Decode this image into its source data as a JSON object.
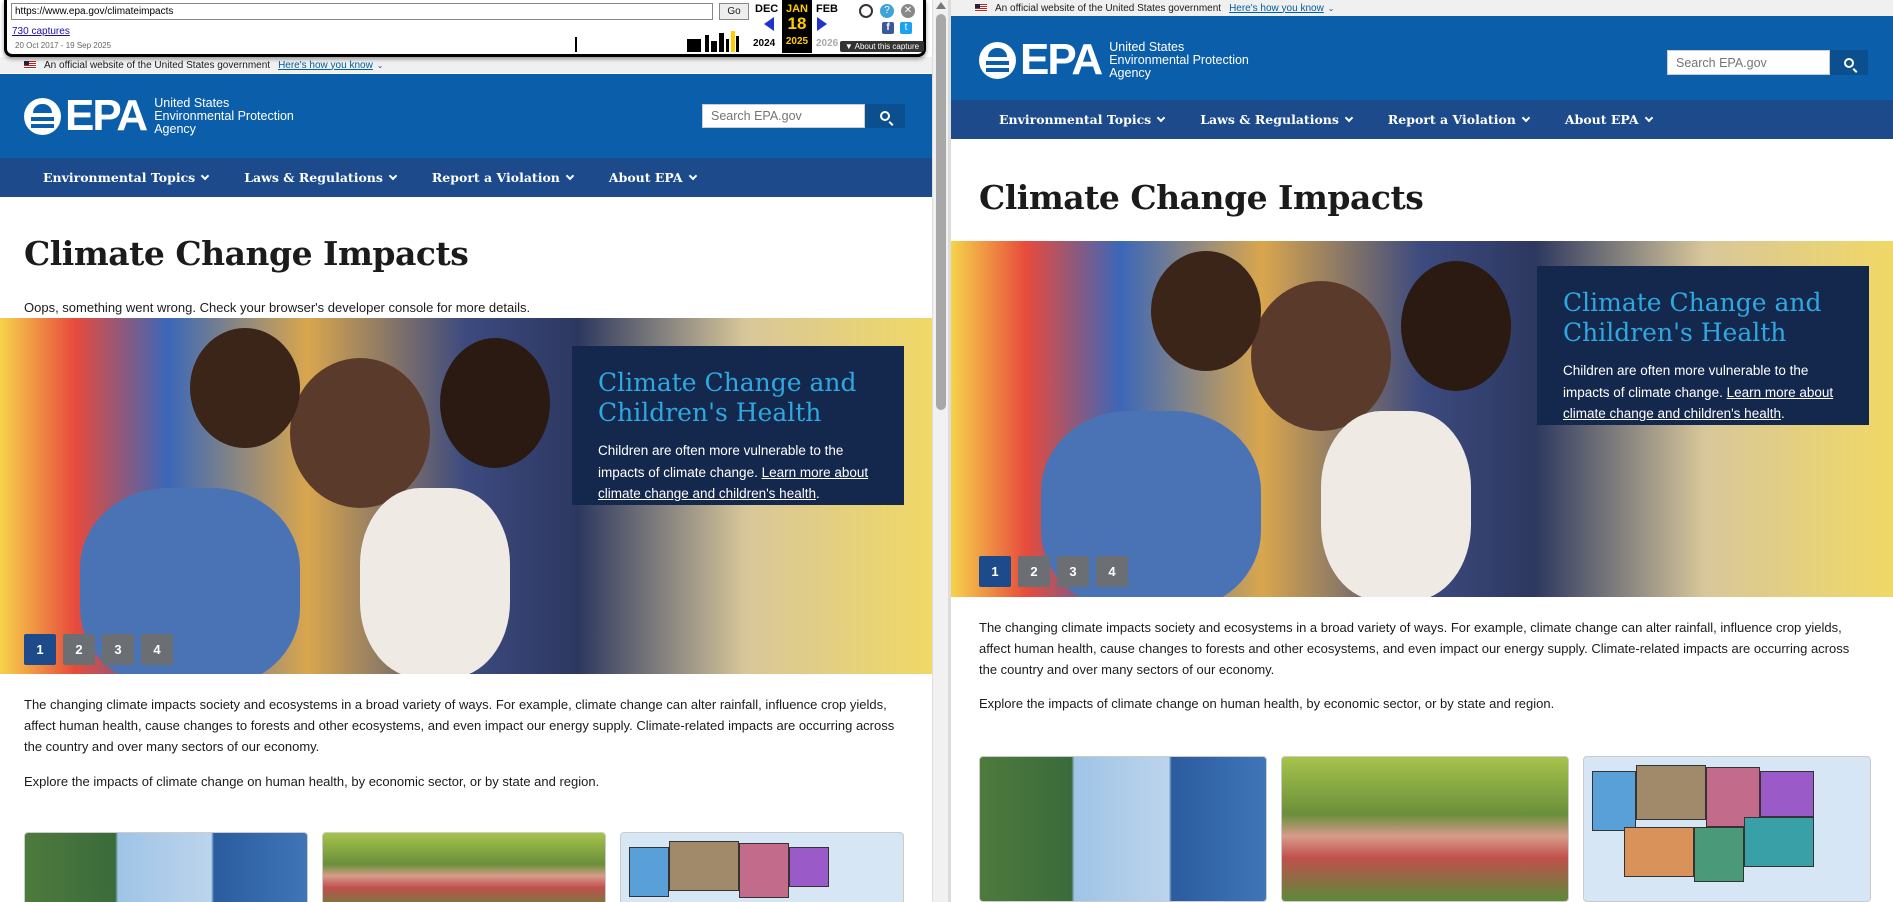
{
  "wayback": {
    "url": "https://www.epa.gov/climateimpacts",
    "go": "Go",
    "captures": "730 captures",
    "range": "20 Oct 2017 - 19 Sep 2025",
    "prev_month": "DEC",
    "prev_year": "2024",
    "cur_month": "JAN",
    "cur_day": "18",
    "cur_year": "2025",
    "next_month": "FEB",
    "next_year": "2026",
    "about": "▼ About this capture"
  },
  "banner": {
    "text": "An official website of the United States government",
    "how": "Here's how you know"
  },
  "header": {
    "logo_epa": "EPA",
    "logo_line1": "United States",
    "logo_line2": "Environmental Protection",
    "logo_line3": "Agency",
    "search_placeholder": "Search EPA.gov"
  },
  "nav": {
    "items": [
      "Environmental Topics",
      "Laws & Regulations",
      "Report a Violation",
      "About EPA"
    ]
  },
  "page": {
    "title": "Climate Change Impacts",
    "error": "Oops, something went wrong. Check your browser's developer console for more details.",
    "hero_title_1": "Climate Change and",
    "hero_title_2": "Children's Health",
    "hero_text": "Children are often more vulnerable to the impacts of climate change.",
    "hero_link": "Learn more about climate change and children's health",
    "hero_end": ".",
    "slides": [
      "1",
      "2",
      "3",
      "4"
    ],
    "para1": "The changing climate impacts society and ecosystems in a broad variety of ways. For example, climate change can alter rainfall, influence crop yields, affect human health, cause changes to forests and other ecosystems, and even impact our energy supply. Climate-related impacts are occurring across the country and over many sectors of our economy.",
    "para2": "Explore the impacts of climate change on human health, by economic sector, or by state and region."
  },
  "colors": {
    "header_blue": "#0b5eaa",
    "nav_blue": "#1c4a8b",
    "card_bg": "#14284e",
    "card_title": "#2fa8e0"
  },
  "icons": [
    "search-icon",
    "caret-down-icon",
    "flag-icon",
    "facebook-icon",
    "twitter-icon",
    "help-icon",
    "close-icon",
    "user-icon"
  ]
}
